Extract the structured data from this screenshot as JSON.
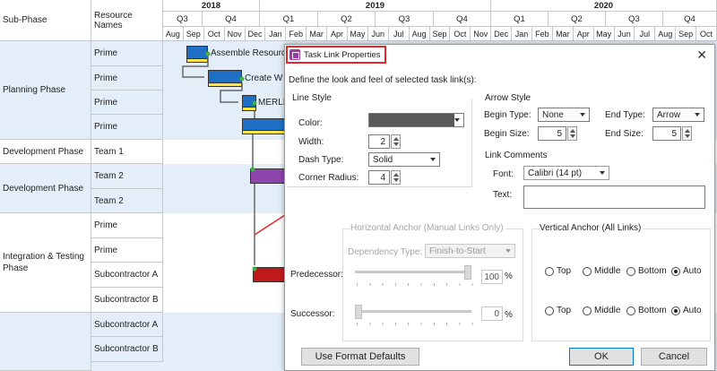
{
  "gantt": {
    "col_subphase": "Sub-Phase",
    "col_resource": "Resource Names",
    "years": [
      "2018",
      "2019",
      "2020"
    ],
    "quarters": [
      "Q3",
      "Q4",
      "Q1",
      "Q2",
      "Q3",
      "Q4",
      "Q1",
      "Q2",
      "Q3",
      "Q4"
    ],
    "months": [
      "Aug",
      "Sep",
      "Oct",
      "Nov",
      "Dec",
      "Jan",
      "Feb",
      "Mar",
      "Apr",
      "May",
      "Jun",
      "Jul",
      "Aug",
      "Sep",
      "Oct",
      "Nov",
      "Dec",
      "Jan",
      "Feb",
      "Mar",
      "Apr",
      "May",
      "Jun",
      "Jul",
      "Aug",
      "Sep",
      "Oct"
    ],
    "phases": [
      "Planning Phase",
      "Development Phase",
      "Development Phase",
      "Integration & Testing Phase"
    ],
    "resources": [
      "Prime",
      "Prime",
      "Prime",
      "Prime",
      "Team 1",
      "Team 2",
      "Team 2",
      "Prime",
      "Prime",
      "Subcontractor A",
      "Subcontractor B",
      "Subcontractor A",
      "Subcontractor B"
    ],
    "task_labels": [
      "Assemble Resource",
      "Create W",
      "MERLIN"
    ]
  },
  "dialog": {
    "title": "Task Link Properties",
    "close": "✕",
    "description": "Define the look and feel of selected task link(s):",
    "line_style": {
      "title": "Line Style",
      "color_label": "Color:",
      "color_value": "#595959",
      "width_label": "Width:",
      "width_value": "2",
      "dash_label": "Dash Type:",
      "dash_value": "Solid",
      "radius_label": "Corner Radius:",
      "radius_value": "4"
    },
    "arrow_style": {
      "title": "Arrow Style",
      "begin_type_label": "Begin Type:",
      "begin_type_value": "None",
      "end_type_label": "End Type:",
      "end_type_value": "Arrow",
      "begin_size_label": "Begin Size:",
      "begin_size_value": "5",
      "end_size_label": "End Size:",
      "end_size_value": "5"
    },
    "link_comments": {
      "title": "Link Comments",
      "font_label": "Font:",
      "font_value": "Calibri (14 pt)",
      "text_label": "Text:",
      "text_value": ""
    },
    "horizontal_anchor": {
      "title": "Horizontal Anchor (Manual Links Only)",
      "dependency_label": "Dependency Type:",
      "dependency_value": "Finish-to-Start",
      "predecessor_label": "Predecessor:",
      "predecessor_value": "100",
      "predecessor_fraction": 1.0,
      "successor_label": "Successor:",
      "successor_value": "0",
      "successor_fraction": 0.0,
      "percent": "%"
    },
    "vertical_anchor": {
      "title": "Vertical Anchor (All Links)",
      "options": [
        "Top",
        "Middle",
        "Bottom",
        "Auto"
      ],
      "predecessor_selected": "Auto",
      "successor_selected": "Auto"
    },
    "buttons": {
      "defaults": "Use Format Defaults",
      "ok": "OK",
      "cancel": "Cancel"
    }
  },
  "colors": {
    "blue_bar": "#1f6fc5",
    "yellow_bar": "#ffe640",
    "purple_bar": "#8e44ad",
    "red_bar": "#c0191c",
    "band": "#e4eef8",
    "pointer_arrow": "#e0282a"
  }
}
